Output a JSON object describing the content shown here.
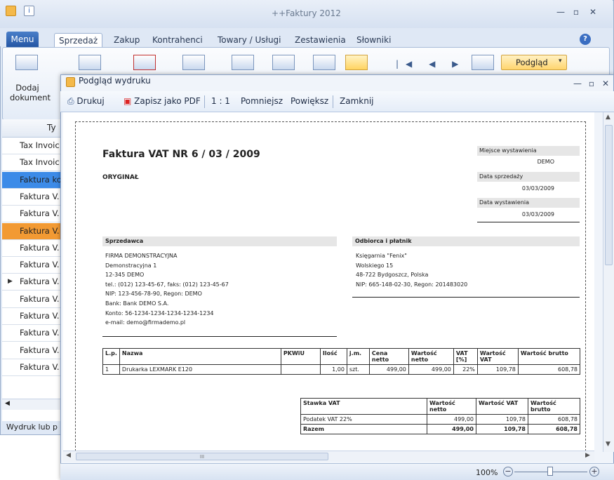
{
  "app": {
    "title": "++Faktury 2012"
  },
  "menu": {
    "menu_label": "Menu",
    "tabs": [
      "Sprzedaż",
      "Zakup",
      "Kontrahenci",
      "Towary / Usługi",
      "Zestawienia",
      "Słowniki"
    ]
  },
  "ribbon": {
    "dodaj_line1": "Dodaj",
    "dodaj_line2": "dokument",
    "podglad": "Podgląd"
  },
  "grid": {
    "header_partial": "Ty",
    "rows": [
      "Tax Invoic",
      "Tax Invoic",
      "Faktura ko",
      "Faktura V.",
      "Faktura V.",
      "Faktura V.",
      "Faktura V.",
      "Faktura V.",
      "Faktura V.",
      "Faktura V.",
      "Faktura V.",
      "Faktura V.",
      "Faktura V.",
      "Faktura V."
    ],
    "selected_row_colors": {
      "2": "#3c8be8",
      "5": "#f29a33"
    },
    "current_row": 8,
    "footer_note": "Wydruk lub p"
  },
  "preview": {
    "title": "Podgląd wydruku",
    "toolbar": {
      "print": "Drukuj",
      "pdf": "Zapisz jako PDF",
      "ratio": "1 : 1",
      "smaller": "Pomniejsz",
      "bigger": "Powiększ",
      "close": "Zamknij"
    },
    "scroll_label": "III",
    "zoom": "100%"
  },
  "invoice": {
    "title": "Faktura VAT NR 6 / 03 / 2009",
    "copy": "ORYGINAŁ",
    "place_label": "Miejsce wystawienia",
    "place": "DEMO",
    "sale_date_label": "Data sprzedaży",
    "sale_date": "03/03/2009",
    "issue_date_label": "Data wystawienia",
    "issue_date": "03/03/2009",
    "seller_label": "Sprzedawca",
    "seller": [
      "FIRMA DEMONSTRACYJNA",
      "Demonstracyjna 1",
      "12-345 DEMO",
      "tel.: (012) 123-45-67, faks: (012) 123-45-67",
      "NIP: 123-456-78-90, Regon: DEMO",
      "Bank: Bank DEMO S.A.",
      "Konto: 56-1234-1234-1234-1234-1234",
      "e-mail: demo@firmademo.pl"
    ],
    "buyer_label": "Odbiorca i płatnik",
    "buyer": [
      "Księgarnia \"Fenix\"",
      "Wolskiego 15",
      "48-722 Bydgoszcz, Polska",
      "NIP: 665-148-02-30, Regon: 201483020"
    ],
    "items_headers": [
      "L.p.",
      "Nazwa",
      "PKWiU",
      "Ilość",
      "j.m.",
      "Cena netto",
      "Wartość netto",
      "VAT [%]",
      "Wartość VAT",
      "Wartość brutto"
    ],
    "items": [
      [
        "1",
        "Drukarka LEXMARK E120",
        "",
        "1,00",
        "szt.",
        "499,00",
        "499,00",
        "22%",
        "109,78",
        "608,78"
      ]
    ],
    "summary_headers": [
      "Stawka VAT",
      "Wartość netto",
      "Wartość VAT",
      "Wartość brutto"
    ],
    "summary": [
      [
        "Podatek VAT 22%",
        "499,00",
        "109,78",
        "608,78"
      ],
      [
        "Razem",
        "499,00",
        "109,78",
        "608,78"
      ]
    ]
  }
}
